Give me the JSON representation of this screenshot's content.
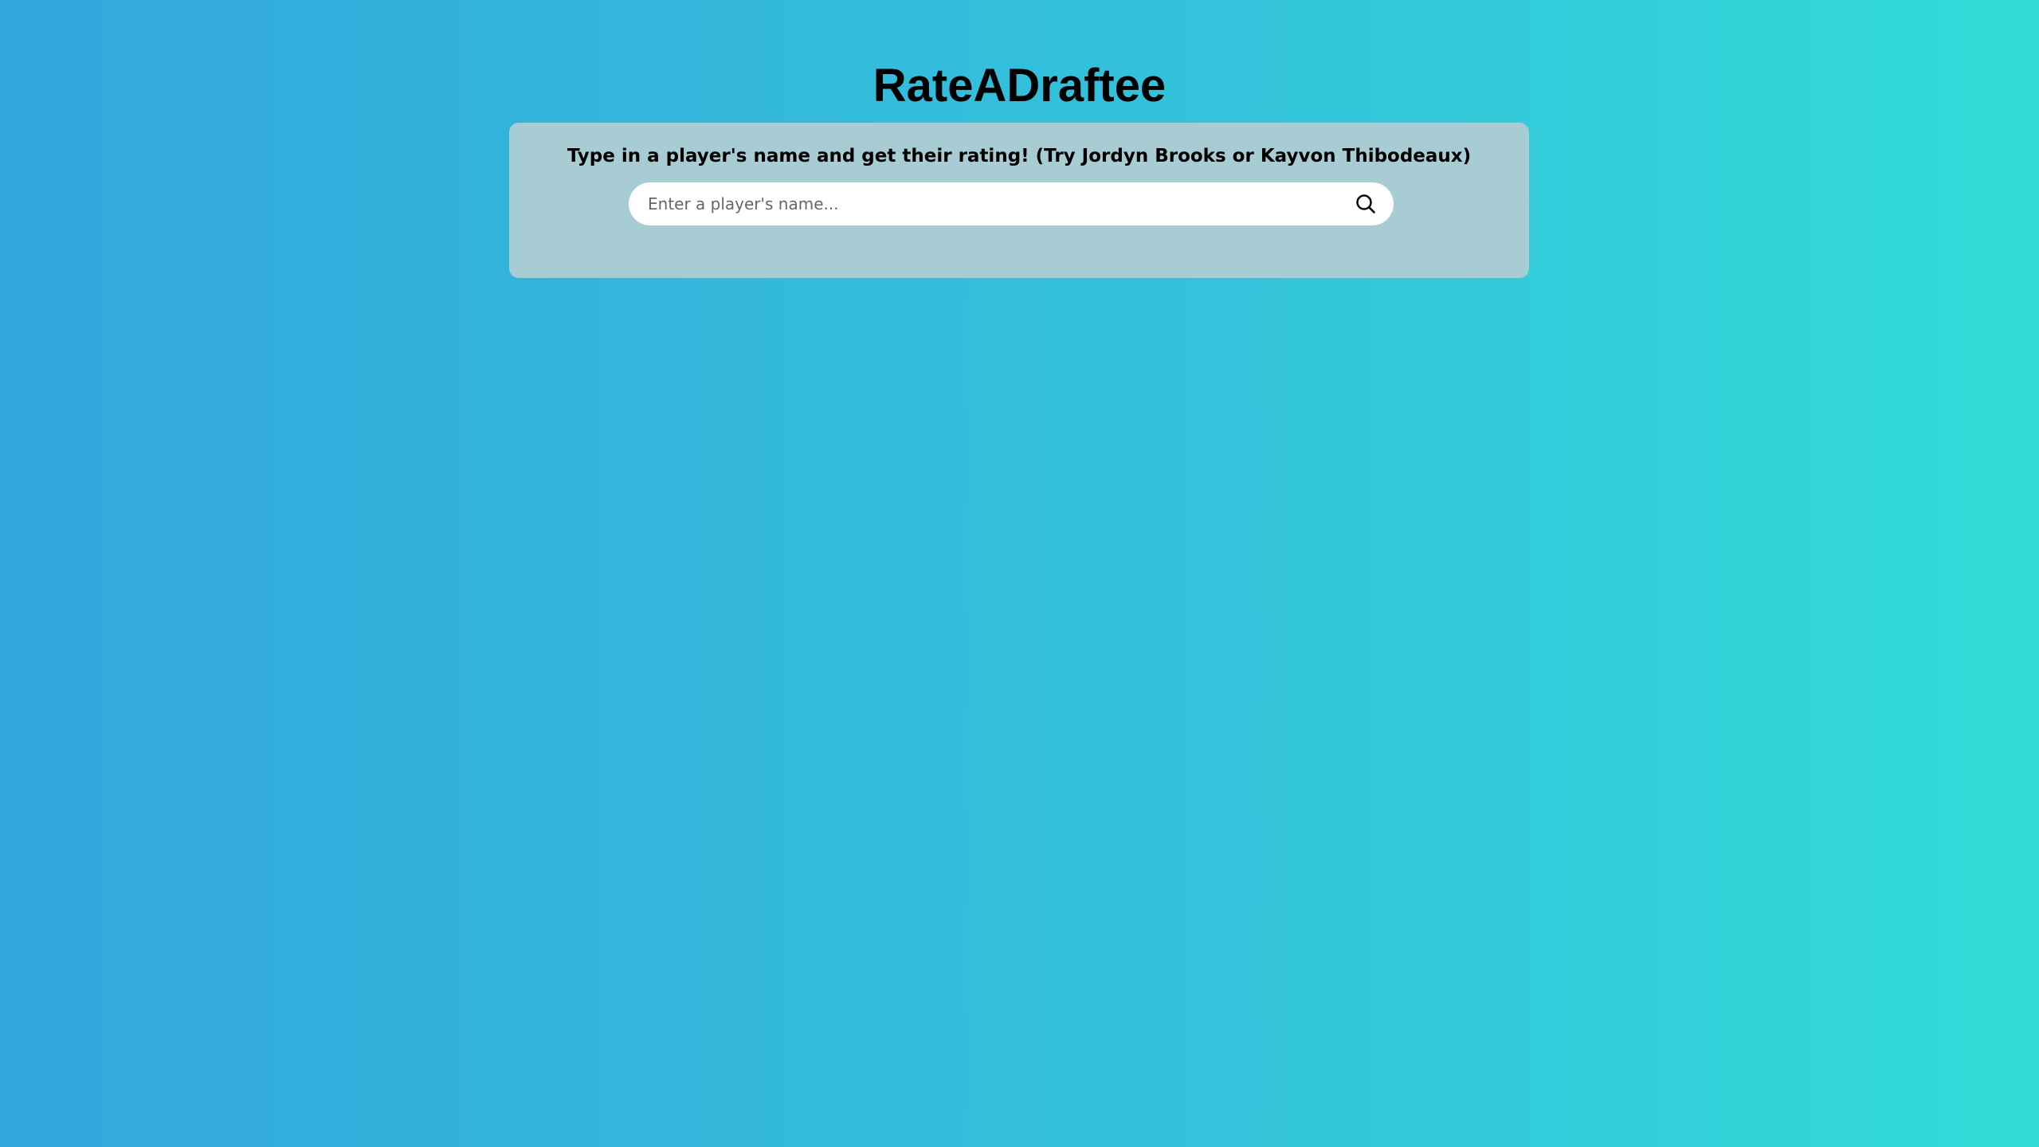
{
  "app": {
    "title": "RateADraftee"
  },
  "search": {
    "instructions": "Type in a player's name and get their rating! (Try Jordyn Brooks or Kayvon Thibodeaux)",
    "placeholder": "Enter a player's name...",
    "value": "",
    "icon": "search-icon"
  },
  "colors": {
    "background_start": "#33a6dc",
    "background_end": "#32dcd8",
    "card_background": "#a8ccd4",
    "input_background": "#ffffff",
    "text": "#000000"
  }
}
